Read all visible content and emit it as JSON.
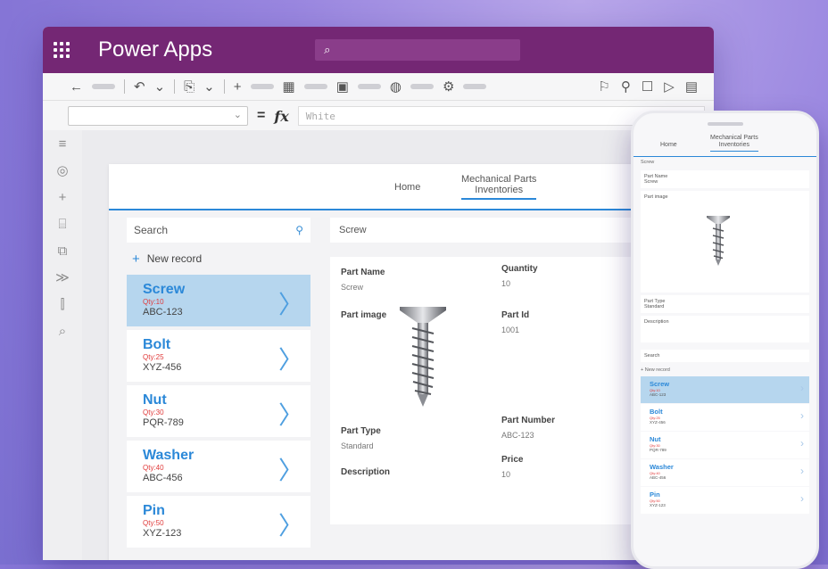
{
  "app": {
    "title": "Power Apps",
    "search_icon": "⌕"
  },
  "formula": {
    "value": "White"
  },
  "screen": {
    "nav_home": "Home",
    "nav_title_1": "Mechanical Parts",
    "nav_title_2": "Inventories",
    "search_placeholder": "Search",
    "new_record": "New record",
    "items": [
      {
        "name": "Screw",
        "qty": "Qty:10",
        "code": "ABC-123"
      },
      {
        "name": "Bolt",
        "qty": "Qty:25",
        "code": "XYZ-456"
      },
      {
        "name": "Nut",
        "qty": "Qty:30",
        "code": "PQR-789"
      },
      {
        "name": "Washer",
        "qty": "Qty:40",
        "code": "ABC-456"
      },
      {
        "name": "Pin",
        "qty": "Qty:50",
        "code": "XYZ-123"
      }
    ],
    "detail": {
      "header": "Screw",
      "part_name_label": "Part Name",
      "part_name": "Screw",
      "quantity_label": "Quantity",
      "quantity": "10",
      "part_image_label": "Part image",
      "part_id_label": "Part Id",
      "part_id": "1001",
      "part_number_label": "Part Number",
      "part_number": "ABC-123",
      "part_type_label": "Part Type",
      "part_type": "Standard",
      "price_label": "Price",
      "price": "10",
      "description_label": "Description"
    }
  },
  "phone": {
    "search": "Search",
    "new_record": "New record",
    "detail_header": "Screw",
    "part_name_label": "Part Name",
    "part_name": "Screw",
    "part_image_label": "Part image",
    "part_type_label": "Part Type",
    "part_type": "Standard",
    "description_label": "Description",
    "items": [
      {
        "name": "Screw",
        "qty": "Qty:10",
        "code": "ABC-123"
      },
      {
        "name": "Bolt",
        "qty": "Qty:25",
        "code": "XYZ-456"
      },
      {
        "name": "Nut",
        "qty": "Qty:30",
        "code": "PQR-789"
      },
      {
        "name": "Washer",
        "qty": "Qty:40",
        "code": "ABC-456"
      },
      {
        "name": "Pin",
        "qty": "Qty:50",
        "code": "XYZ-123"
      }
    ]
  },
  "colors": {
    "brand": "#742774",
    "accent": "#2b88d8",
    "selected": "#b6d6ee",
    "qty_red": "#e03a3a"
  }
}
